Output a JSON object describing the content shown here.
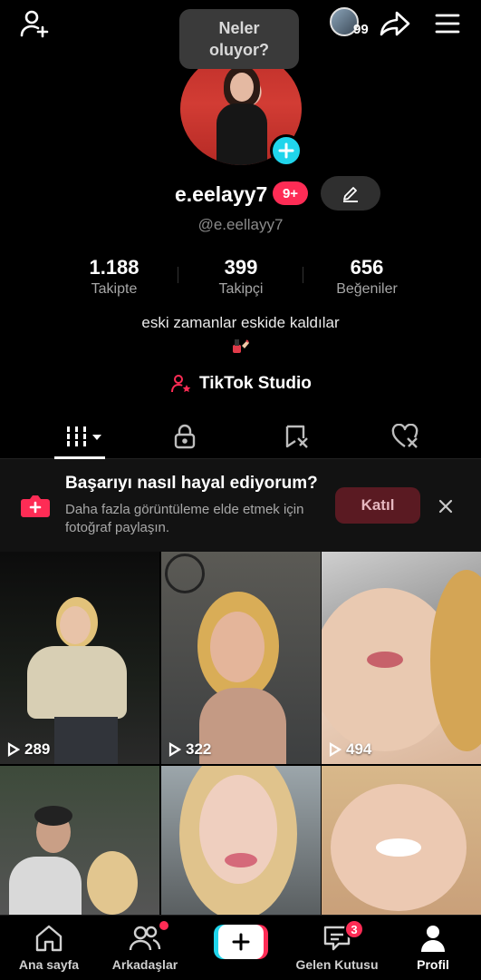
{
  "tooltip": {
    "text": "Neler oluyor?"
  },
  "stories": {
    "count": "99"
  },
  "profile": {
    "username": "e.eelayy7",
    "notification_badge": "9+",
    "handle": "@e.eellayy7",
    "bio": "eski zamanlar eskide kaldılar",
    "studio_label": "TikTok Studio"
  },
  "stats": [
    {
      "value": "1.188",
      "label": "Takipte"
    },
    {
      "value": "399",
      "label": "Takipçi"
    },
    {
      "value": "656",
      "label": "Beğeniler"
    }
  ],
  "tabs": [
    {
      "icon": "grid-icon",
      "active": true
    },
    {
      "icon": "lock-icon",
      "active": false
    },
    {
      "icon": "repost-icon",
      "active": false
    },
    {
      "icon": "liked-icon",
      "active": false
    }
  ],
  "banner": {
    "title": "Başarıyı nasıl hayal ediyorum?",
    "subtitle": "Daha fazla görüntüleme elde etmek için fotoğraf paylaşın.",
    "join_label": "Katıl"
  },
  "videos": [
    {
      "views": "289"
    },
    {
      "views": "322"
    },
    {
      "views": "494"
    },
    {
      "views": ""
    },
    {
      "views": ""
    },
    {
      "views": ""
    }
  ],
  "nav": {
    "home": "Ana sayfa",
    "friends": "Arkadaşlar",
    "inbox": "Gelen Kutusu",
    "inbox_badge": "3",
    "profile": "Profil"
  },
  "colors": {
    "accent": "#fe2c55",
    "cyan": "#20d5ec",
    "background": "#000000"
  }
}
